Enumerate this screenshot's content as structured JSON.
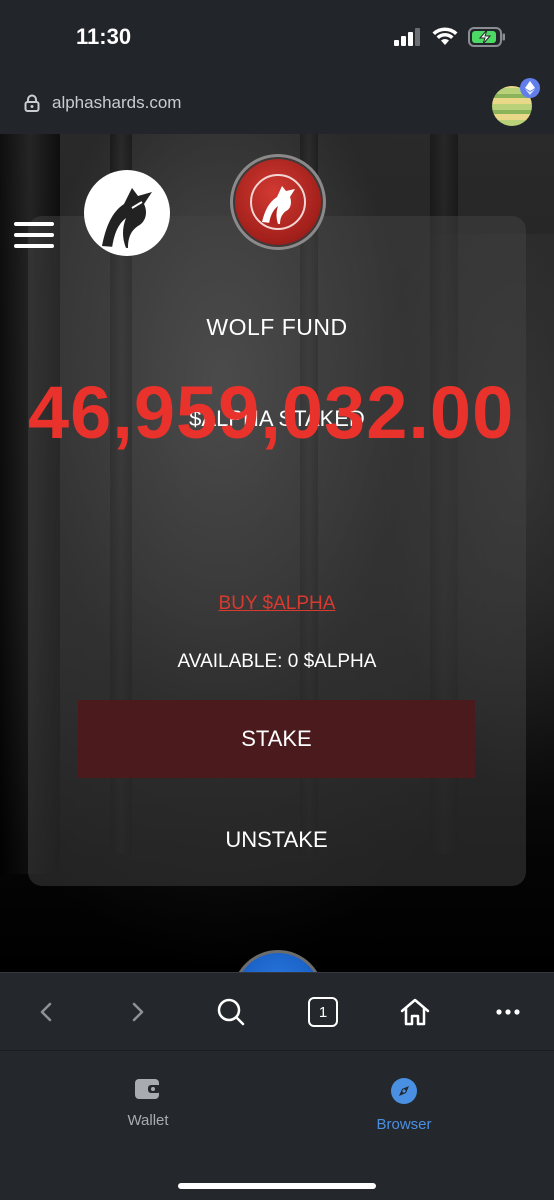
{
  "status_bar": {
    "time": "11:30"
  },
  "url_bar": {
    "url": "alphashards.com"
  },
  "page": {
    "card_title": "WOLF FUND",
    "staked_label": "$ALPHA STAKED",
    "staked_amount": "46,959,032.00",
    "buy_link": "BUY $ALPHA",
    "available_text": "AVAILABLE: 0 $ALPHA",
    "stake_button": "STAKE",
    "unstake_button": "UNSTAKE"
  },
  "toolbar": {
    "tab_count": "1"
  },
  "tabbar": {
    "wallet_label": "Wallet",
    "browser_label": "Browser"
  },
  "colors": {
    "accent_red": "#e8322b",
    "active_tab_blue": "#4a90e2",
    "stake_button_bg": "#4a1a1c"
  }
}
